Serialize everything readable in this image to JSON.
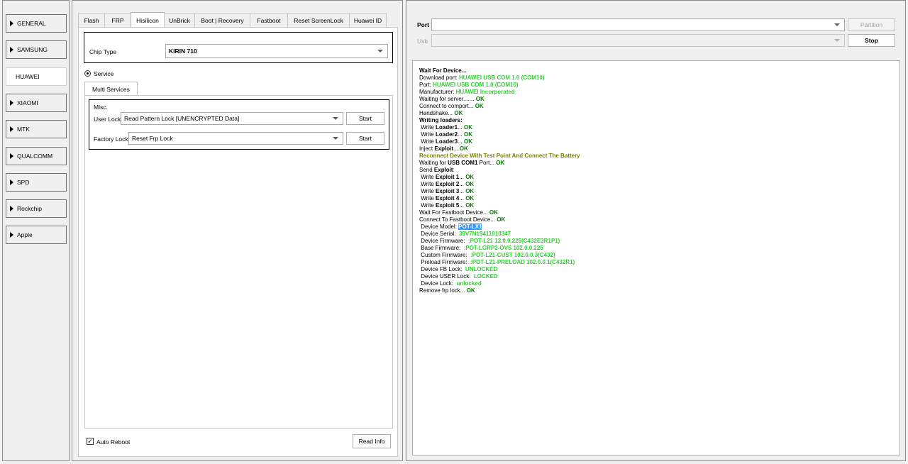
{
  "brands": [
    "GENERAL",
    "SAMSUNG",
    "HUAWEI",
    "XIAOMI",
    "MTK",
    "QUALCOMM",
    "SPD",
    "Rockchip",
    "Apple"
  ],
  "active_brand": "HUAWEI",
  "tabs": [
    "Flash",
    "FRP",
    "Hisilicon",
    "UnBrick",
    "Boot | Recovery",
    "Fastboot",
    "Reset ScreenLock",
    "Huawei ID"
  ],
  "active_tab": "Hisilicon",
  "chip": {
    "label": "Chip Type",
    "value": "KIRIN 710"
  },
  "service_radio": "Service",
  "subtab": "Multi Services",
  "misc": {
    "title": "Misc.",
    "user_lock_label": "User Lock",
    "user_lock_value": "Read Pattern Lock [UNENCRYPTED Data]",
    "factory_lock_label": "Factory Lock",
    "factory_lock_value": "Reset Frp Lock",
    "start_label": "Start"
  },
  "auto_reboot": {
    "label": "Auto Reboot",
    "checked": true
  },
  "read_info_label": "Read Info",
  "port": {
    "label": "Port",
    "value": ""
  },
  "usb": {
    "label": "Usb",
    "value": ""
  },
  "partition_label": "Partition",
  "stop_label": "Stop",
  "colors": {
    "ok": "#008000",
    "value": "#30d030",
    "warn": "#808000",
    "highlight": "#3399ff"
  },
  "log": [
    [
      [
        "Wait For Device...",
        "k"
      ]
    ],
    [
      [
        "Download port: ",
        ""
      ],
      [
        "HUAWEI USB COM 1.0 (COM10)",
        "g"
      ]
    ],
    [
      [
        "Port: ",
        ""
      ],
      [
        "HUAWEI USB COM 1.0 (COM10)",
        "g"
      ]
    ],
    [
      [
        "Manufacturer: ",
        ""
      ],
      [
        "HUAWEI Incorporated",
        "g"
      ]
    ],
    [
      [
        "Waiting for server....... ",
        ""
      ],
      [
        "OK",
        "ok"
      ]
    ],
    [
      [
        "Connect to comport... ",
        ""
      ],
      [
        "OK",
        "ok"
      ]
    ],
    [
      [
        "Handshake... ",
        ""
      ],
      [
        "OK",
        "ok"
      ]
    ],
    [
      [
        "Writing loaders:",
        "k"
      ]
    ],
    [
      [
        " Write ",
        ""
      ],
      [
        "Loader1",
        "k"
      ],
      [
        "... ",
        ""
      ],
      [
        "OK",
        "ok"
      ]
    ],
    [
      [
        " Write ",
        ""
      ],
      [
        "Loader2",
        "k"
      ],
      [
        "... ",
        ""
      ],
      [
        "OK",
        "ok"
      ]
    ],
    [
      [
        " Write ",
        ""
      ],
      [
        "Loader3",
        "k"
      ],
      [
        "... ",
        ""
      ],
      [
        "OK",
        "ok"
      ]
    ],
    [
      [
        "Inject ",
        ""
      ],
      [
        "Exploit",
        "k"
      ],
      [
        "... ",
        ""
      ],
      [
        "OK",
        "ok"
      ]
    ],
    [
      [
        "Reconnect Device With Test Point And Connect The Battery",
        "warn"
      ]
    ],
    [
      [
        "Waiting for ",
        ""
      ],
      [
        "USB COM1",
        "k"
      ],
      [
        " Port... ",
        ""
      ],
      [
        "OK",
        "ok"
      ]
    ],
    [
      [
        "Send ",
        ""
      ],
      [
        "Exploit",
        "k"
      ],
      [
        ":",
        ""
      ]
    ],
    [
      [
        " Write ",
        ""
      ],
      [
        "Exploit 1",
        "k"
      ],
      [
        "... ",
        ""
      ],
      [
        "OK",
        "ok"
      ]
    ],
    [
      [
        " Write ",
        ""
      ],
      [
        "Exploit 2",
        "k"
      ],
      [
        "... ",
        ""
      ],
      [
        "OK",
        "ok"
      ]
    ],
    [
      [
        " Write ",
        ""
      ],
      [
        "Exploit 3",
        "k"
      ],
      [
        "... ",
        ""
      ],
      [
        "OK",
        "ok"
      ]
    ],
    [
      [
        " Write ",
        ""
      ],
      [
        "Exploit 4",
        "k"
      ],
      [
        "... ",
        ""
      ],
      [
        "OK",
        "ok"
      ]
    ],
    [
      [
        " Write ",
        ""
      ],
      [
        "Exploit 5",
        "k"
      ],
      [
        "... ",
        ""
      ],
      [
        "OK",
        "ok"
      ]
    ],
    [
      [
        "Wait For Fastboot Device... ",
        ""
      ],
      [
        "OK",
        "ok"
      ]
    ],
    [
      [
        "Connect To Fastboot Device... ",
        ""
      ],
      [
        "OK",
        "ok"
      ]
    ],
    [
      [
        " Device Model: ",
        ""
      ],
      [
        "POT-LX1",
        "hl"
      ]
    ],
    [
      [
        " Device Serial:  ",
        ""
      ],
      [
        "39V7N19411010347",
        "g"
      ]
    ],
    [
      [
        " Device Firmware:  ",
        ""
      ],
      [
        ":POT-L21 12.0.0.225(C432E3R1P1)",
        "g"
      ]
    ],
    [
      [
        " Base Firmware:  ",
        ""
      ],
      [
        ":POT-LGRP2-OVS 102.0.0.225",
        "g"
      ]
    ],
    [
      [
        " Custom Firmware:  ",
        ""
      ],
      [
        ":POT-L21-CUST 102.0.0.3(C432)",
        "g"
      ]
    ],
    [
      [
        " Preload Firmware:  ",
        ""
      ],
      [
        ":POT-L21-PRELOAD 102.0.0.1(C432R1)",
        "g"
      ]
    ],
    [
      [
        " Device FB Lock:  ",
        ""
      ],
      [
        "UNLOCKED",
        "g"
      ]
    ],
    [
      [
        " Device USER Lock:  ",
        ""
      ],
      [
        "LOCKED",
        "g"
      ]
    ],
    [
      [
        " Device Lock:  ",
        ""
      ],
      [
        "unlocked",
        "g"
      ]
    ],
    [
      [
        "Remove frp lock... ",
        ""
      ],
      [
        "OK",
        "ok"
      ]
    ]
  ]
}
